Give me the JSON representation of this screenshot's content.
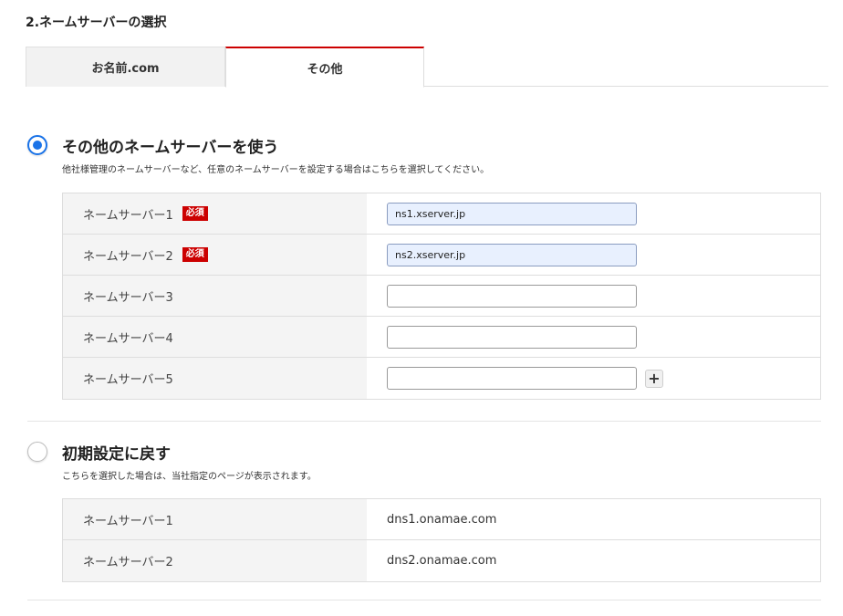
{
  "section_title": "2.ネームサーバーの選択",
  "tabs": [
    {
      "label": "お名前.com",
      "active": false
    },
    {
      "label": "その他",
      "active": true
    }
  ],
  "option_other": {
    "title": "その他のネームサーバーを使う",
    "description": "他社様管理のネームサーバーなど、任意のネームサーバーを設定する場合はこちらを選択してください。",
    "selected": true,
    "rows": [
      {
        "label": "ネームサーバー1",
        "badge": "必須",
        "value": "ns1.xserver.jp"
      },
      {
        "label": "ネームサーバー2",
        "badge": "必須",
        "value": "ns2.xserver.jp"
      },
      {
        "label": "ネームサーバー3",
        "value": ""
      },
      {
        "label": "ネームサーバー4",
        "value": ""
      },
      {
        "label": "ネームサーバー5",
        "value": ""
      }
    ],
    "add_button": "+"
  },
  "option_default": {
    "title": "初期設定に戻す",
    "description": "こちらを選択した場合は、当社指定のページが表示されます。",
    "selected": false,
    "rows": [
      {
        "label": "ネームサーバー1",
        "value": "dns1.onamae.com"
      },
      {
        "label": "ネームサーバー2",
        "value": "dns2.onamae.com"
      }
    ]
  },
  "colors": {
    "accent_red": "#cc0000",
    "radio_blue": "#1a73e8",
    "autofill_bg": "#e8f0fe"
  }
}
